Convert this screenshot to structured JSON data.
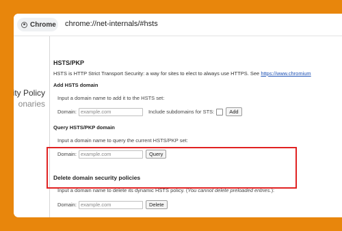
{
  "browser": {
    "chip_label": "Chrome",
    "url": "chrome://net-internals/#hsts"
  },
  "sidebar": {
    "items": [
      {
        "label": "rity Policy"
      },
      {
        "label": "onaries"
      }
    ]
  },
  "page": {
    "title": "HSTS/PKP",
    "description": "HSTS is HTTP Strict Transport Security: a way for sites to elect to always use HTTPS. See",
    "description_link": "https://www.chromium",
    "add": {
      "heading": "Add HSTS domain",
      "instruction": "Input a domain name to add it to the HSTS set:",
      "domain_label": "Domain:",
      "domain_placeholder": "example.com",
      "subdomains_label": "Include subdomains for STS:",
      "button": "Add"
    },
    "query": {
      "heading": "Query HSTS/PKP domain",
      "instruction": "Input a domain name to query the current HSTS/PKP set:",
      "domain_label": "Domain:",
      "domain_placeholder": "example.com",
      "button": "Query"
    },
    "delete": {
      "heading": "Delete domain security policies",
      "instruction": "Input a domain name to delete its dynamic HSTS policy. (",
      "instruction_note": "You cannot delete preloaded entries.",
      "instruction_end": "):",
      "domain_label": "Domain:",
      "domain_placeholder": "example.com",
      "button": "Delete"
    }
  },
  "colors": {
    "background": "#E8860C",
    "highlight": "#E02020",
    "link": "#1A4FB4"
  }
}
